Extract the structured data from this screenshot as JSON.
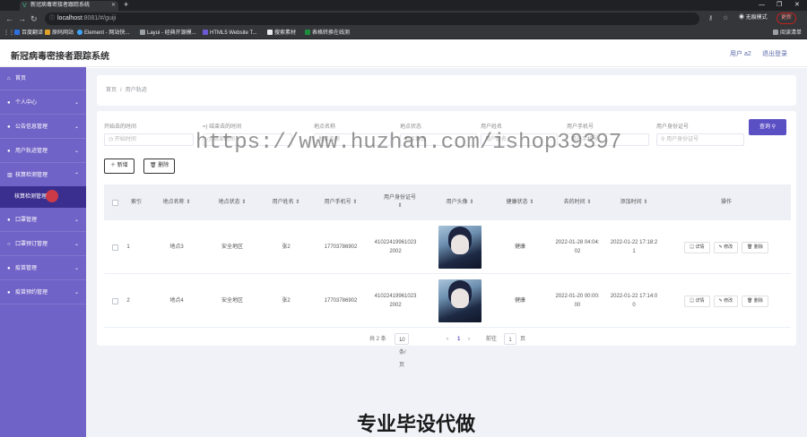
{
  "browser": {
    "tab_title": "新冠病毒密接者跟踪系统",
    "url_host": "localhost",
    "url_path": ":8081/#/guiji",
    "profile_label": "无痕模式",
    "update_label": "更新",
    "bookmarks": [
      "百度翻译",
      "原码网站",
      "Element - 网站快...",
      "Layui - 经典开源模...",
      "HTML5 Website T...",
      "搜索素材",
      "表格转换在线测"
    ],
    "reading_list": "阅读清单",
    "tab_icon": "vue-logo-icon"
  },
  "header": {
    "title": "新冠病毒密接者跟踪系统",
    "user_label": "用户 a2",
    "logout_label": "退出登录"
  },
  "sidebar": {
    "items": [
      {
        "label": "首页",
        "icon": "home-icon",
        "has_chevron": false
      },
      {
        "label": "个人中心",
        "icon": "user-icon",
        "has_chevron": true
      },
      {
        "label": "公告信息管理",
        "icon": "user-icon",
        "has_chevron": true
      },
      {
        "label": "用户轨迹管理",
        "icon": "user-icon",
        "has_chevron": true
      },
      {
        "label": "核算检测管理",
        "icon": "chart-icon",
        "has_chevron": true,
        "expanded": true
      },
      {
        "label": "口罩管理",
        "icon": "user-icon",
        "has_chevron": true
      },
      {
        "label": "口罩预订管理",
        "icon": "user-icon",
        "has_chevron": true
      },
      {
        "label": "疫苗管理",
        "icon": "user-icon",
        "has_chevron": true
      },
      {
        "label": "疫苗预约管理",
        "icon": "user-icon",
        "has_chevron": true
      }
    ],
    "sub_item": "核算检测管理"
  },
  "breadcrumb": {
    "home": "首页",
    "separator": "/",
    "current": "用户轨迹"
  },
  "filters": [
    {
      "label": "开始去的时间",
      "placeholder": "开始时间",
      "type": "date"
    },
    {
      "label": "结束去的时间",
      "placeholder": "结束时间",
      "type": "date"
    },
    {
      "label": "地点名称",
      "placeholder": "地点名称",
      "type": "text"
    },
    {
      "label": "地点状态",
      "placeholder": "地点状态",
      "type": "select"
    },
    {
      "label": "用户姓名",
      "placeholder": "用户姓名",
      "type": "text"
    },
    {
      "label": "用户手机号",
      "placeholder": "用户手机号",
      "type": "text"
    },
    {
      "label": "用户身份证号",
      "placeholder": "用户身份证号",
      "type": "text"
    }
  ],
  "query_button": "查询",
  "actions": {
    "add": "新增",
    "delete": "删除"
  },
  "table": {
    "columns": [
      "索引",
      "地点名称",
      "地点状态",
      "用户姓名",
      "用户手机号",
      "用户身份证号",
      "用户头像",
      "健康状态",
      "去的时间",
      "添加时间",
      "操作"
    ],
    "rows": [
      {
        "index": "1",
        "place": "地点3",
        "status": "安全地区",
        "name": "张2",
        "phone": "17703786902",
        "id_number": "410224199610232002",
        "health": "健康",
        "go_time": "2022-01-28 04:04:02",
        "add_time": "2022-01-22 17:18:21"
      },
      {
        "index": "2",
        "place": "地点4",
        "status": "安全地区",
        "name": "张2",
        "phone": "17703786902",
        "id_number": "410224199610232002",
        "health": "健康",
        "go_time": "2022-01-20 00:00:00",
        "add_time": "2022-01-22 17:14:00"
      }
    ],
    "row_actions": [
      "详情",
      "修改",
      "删除"
    ]
  },
  "pagination": {
    "total": "共 2 条",
    "page_size": "10条/页",
    "current_page": "1",
    "goto_label": "前往",
    "goto_value": "1",
    "page_unit": "页"
  },
  "overlay": {
    "watermark": "https://www.huzhan.com/ishop39397",
    "promo": "专业毕设代做"
  }
}
